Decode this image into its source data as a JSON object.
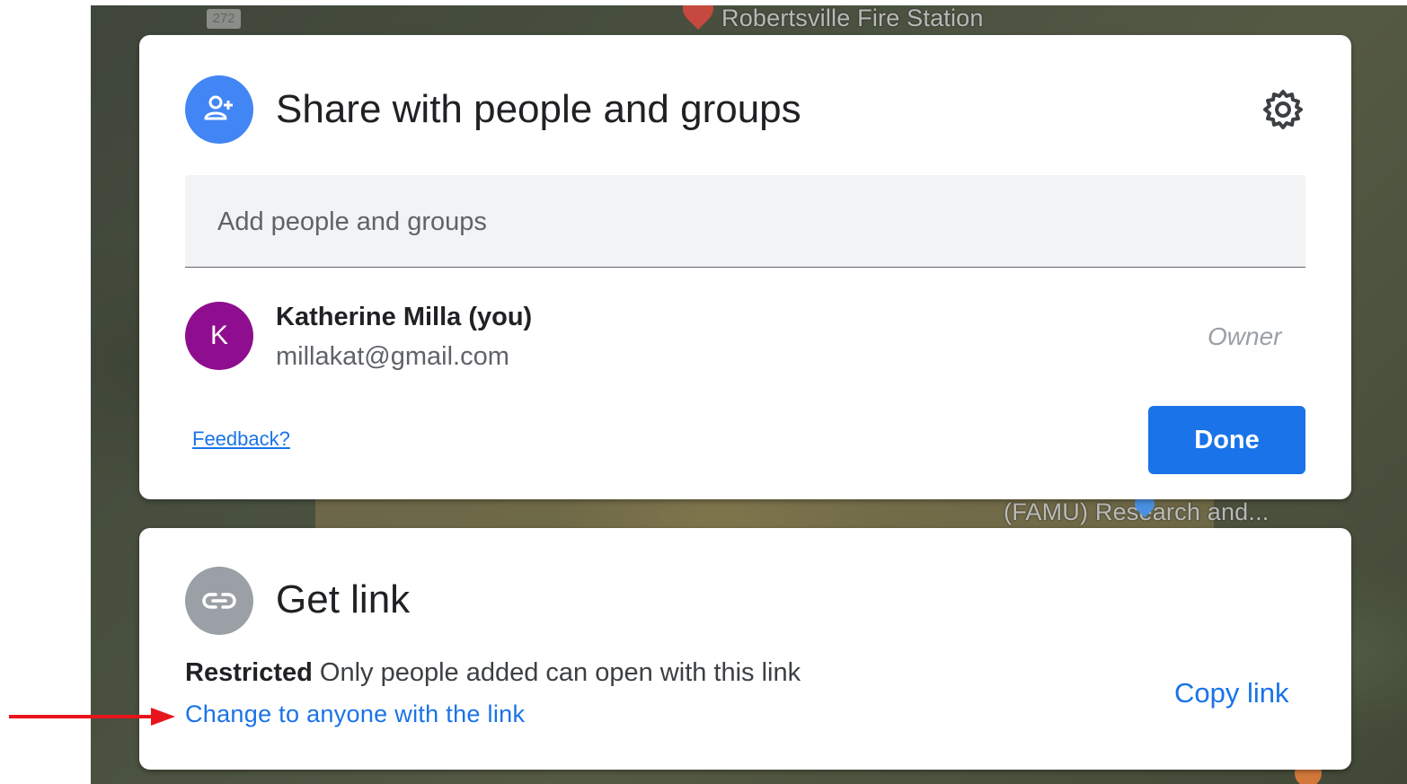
{
  "map": {
    "shield_label": "272",
    "labels": [
      "Robertsville Fire Station",
      "(FAMU) Research and..."
    ]
  },
  "share_dialog": {
    "title": "Share with people and groups",
    "add_people_placeholder": "Add people and groups",
    "people": [
      {
        "initial": "K",
        "name": "Katherine Milla (you)",
        "email": "millakat@gmail.com",
        "role": "Owner",
        "avatar_color": "#8e0e8f"
      }
    ],
    "feedback_label": "Feedback?",
    "done_label": "Done"
  },
  "link_dialog": {
    "title": "Get link",
    "restriction_label": "Restricted",
    "restriction_description": "Only people added can open with this link",
    "change_label": "Change to anyone with the link",
    "copy_label": "Copy link"
  },
  "colors": {
    "accent": "#1a73e8",
    "share_icon_bg": "#4285f4",
    "link_icon_bg": "#9aa0a6",
    "annotation_arrow": "#e8141b"
  }
}
